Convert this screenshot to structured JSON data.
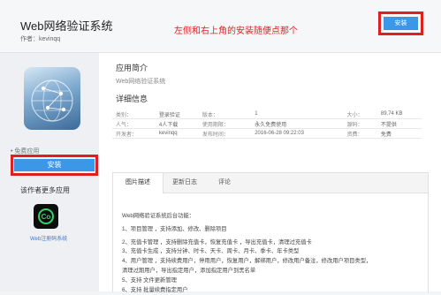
{
  "header": {
    "title": "Web网络验证系统",
    "author": "作者：kevinqq",
    "annotation": "左侧和右上角的安装随便点那个",
    "install_label": "安装"
  },
  "sidebar": {
    "free_label": "• 免费应用",
    "install_label": "安装",
    "more_title": "该作者更多应用",
    "more_app_name": "Web注册码系统",
    "more_app_glyph": "Co"
  },
  "main": {
    "intro_title": "应用简介",
    "intro_text": "Web网络验证系统",
    "details_title": "详细信息",
    "details": [
      [
        "类别：",
        "登录验证",
        "版本：",
        "1",
        "大小：",
        "89.74 KB"
      ],
      [
        "人气：",
        "4人下载",
        "使用期限：",
        "永久免费使用",
        "源码：",
        "不提供"
      ],
      [
        "开发者：",
        "kevinqq",
        "发布时间：",
        "2016-06-28 09:22:03",
        "资费：",
        "免费"
      ]
    ],
    "tabs": [
      "图片描述",
      "更新日志",
      "评论"
    ],
    "description": [
      "Web网络验证系统后台功能：",
      "1、项目管理 ，支持添加、修改、删除项目",
      "2、充值卡管理 ，支持删除充值卡，恢复充值卡 ，导出充值卡，清理过充值卡",
      "3、充值卡生成 ，支持分钟、时卡、天卡、周卡、月卡、季卡、年卡类型",
      "4、用户管理 ，支持续费用户，停用用户，恢复用户，解绑用户，修改用户备注，修改用户项目类型，",
      "    清理过期用户，导出指定用户，添加指定用户到黑名单",
      "5、支持 文件更新管理",
      "6、支持 批量续费指定用户"
    ]
  },
  "colors": {
    "accent": "#3b98e8",
    "highlight": "#e02020"
  }
}
